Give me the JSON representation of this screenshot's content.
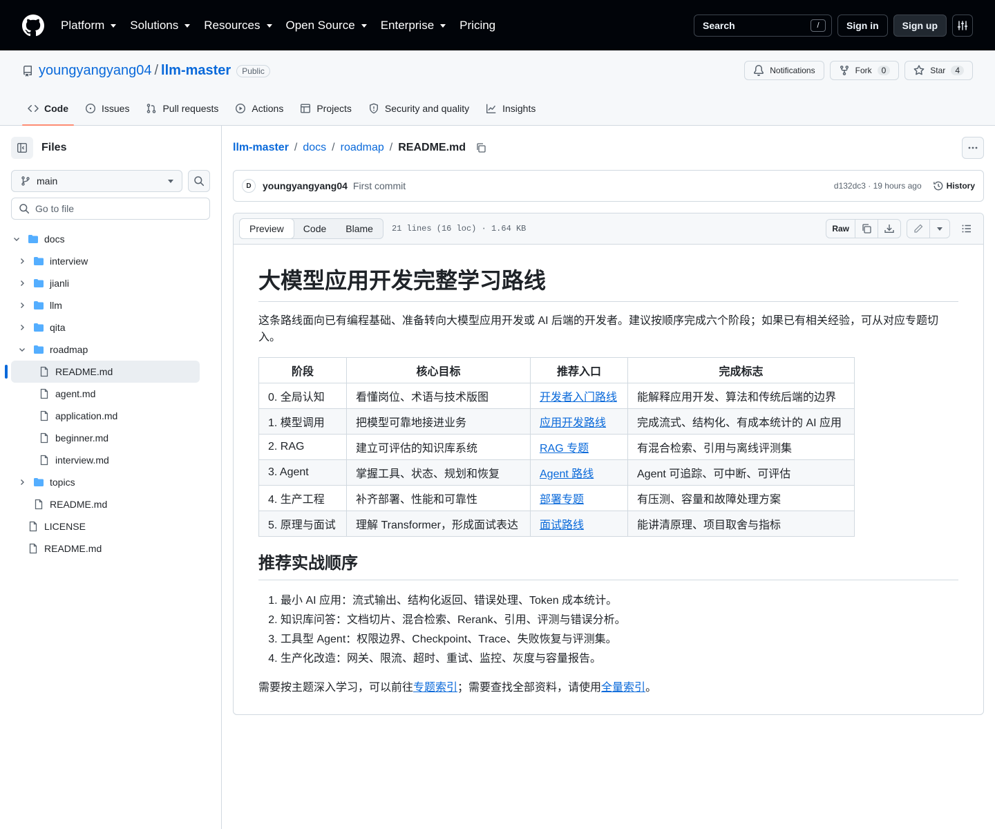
{
  "topnav": {
    "items": [
      {
        "label": "Platform"
      },
      {
        "label": "Solutions"
      },
      {
        "label": "Resources"
      },
      {
        "label": "Open Source"
      },
      {
        "label": "Enterprise"
      },
      {
        "label": "Pricing"
      }
    ],
    "search_label": "Search",
    "search_key": "/",
    "signin_label": "Sign in",
    "signup_label": "Sign up"
  },
  "repo": {
    "owner": "youngyangyang04",
    "name": "llm-master",
    "visibility": "Public",
    "notifications_label": "Notifications",
    "fork_label": "Fork",
    "fork_count": "0",
    "star_label": "Star",
    "star_count": "4",
    "tabs": [
      "Code",
      "Issues",
      "Pull requests",
      "Actions",
      "Projects",
      "Security and quality",
      "Insights"
    ]
  },
  "sidebar": {
    "title": "Files",
    "branch": "main",
    "goto_placeholder": "Go to file",
    "tree": [
      {
        "label": "docs"
      },
      {
        "label": "interview"
      },
      {
        "label": "jianli"
      },
      {
        "label": "llm"
      },
      {
        "label": "qita"
      },
      {
        "label": "roadmap"
      },
      {
        "label": "README.md"
      },
      {
        "label": "agent.md"
      },
      {
        "label": "application.md"
      },
      {
        "label": "beginner.md"
      },
      {
        "label": "interview.md"
      },
      {
        "label": "topics"
      },
      {
        "label": "README.md"
      },
      {
        "label": "LICENSE"
      },
      {
        "label": "README.md"
      }
    ]
  },
  "breadcrumb": {
    "root": "llm-master",
    "parts": [
      "docs",
      "roadmap"
    ],
    "file": "README.md",
    "sep": "/"
  },
  "commit": {
    "author": "youngyangyang04",
    "message": "First commit",
    "meta": "d132dc3 · 19 hours ago",
    "history_label": "History"
  },
  "file": {
    "tabs": [
      "Preview",
      "Code",
      "Blame"
    ],
    "info": "21 lines (16 loc) · 1.64 KB",
    "raw_label": "Raw"
  },
  "readme": {
    "h1": "大模型应用开发完整学习路线",
    "intro": "这条路线面向已有编程基础、准备转向大模型应用开发或 AI 后端的开发者。建议按顺序完成六个阶段；如果已有相关经验，可从对应专题切入。",
    "table_headers": [
      "阶段",
      "核心目标",
      "推荐入口",
      "完成标志"
    ],
    "table_rows": [
      {
        "stage": "0. 全局认知",
        "goal": "看懂岗位、术语与技术版图",
        "entry": "开发者入门路线",
        "done": "能解释应用开发、算法和传统后端的边界"
      },
      {
        "stage": "1. 模型调用",
        "goal": "把模型可靠地接进业务",
        "entry": "应用开发路线",
        "done": "完成流式、结构化、有成本统计的 AI 应用"
      },
      {
        "stage": "2. RAG",
        "goal": "建立可评估的知识库系统",
        "entry": "RAG 专题",
        "done": "有混合检索、引用与离线评测集"
      },
      {
        "stage": "3. Agent",
        "goal": "掌握工具、状态、规划和恢复",
        "entry": "Agent 路线",
        "done": "Agent 可追踪、可中断、可评估"
      },
      {
        "stage": "4. 生产工程",
        "goal": "补齐部署、性能和可靠性",
        "entry": "部署专题",
        "done": "有压测、容量和故障处理方案"
      },
      {
        "stage": "5. 原理与面试",
        "goal": "理解 Transformer，形成面试表达",
        "entry": "面试路线",
        "done": "能讲清原理、项目取舍与指标"
      }
    ],
    "h2": "推荐实战顺序",
    "steps": [
      "最小 AI 应用：流式输出、结构化返回、错误处理、Token 成本统计。",
      "知识库问答：文档切片、混合检索、Rerank、引用、评测与错误分析。",
      "工具型 Agent：权限边界、Checkpoint、Trace、失败恢复与评测集。",
      "生产化改造：网关、限流、超时、重试、监控、灰度与容量报告。"
    ],
    "outro_a": "需要按主题深入学习，可以前往",
    "outro_link1": "专题索引",
    "outro_b": "；需要查找全部资料，请使用",
    "outro_link2": "全量索引",
    "outro_c": "。"
  }
}
